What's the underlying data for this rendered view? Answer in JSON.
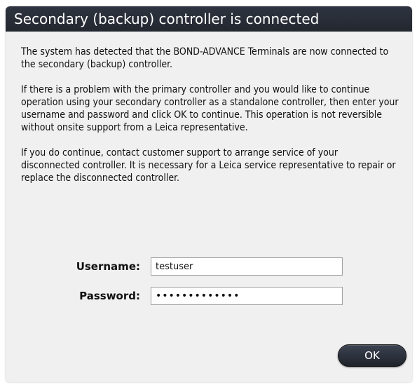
{
  "dialog": {
    "title": "Secondary (backup) controller is connected",
    "paragraphs": [
      "The system has detected that the BOND-ADVANCE Terminals are now connected to the secondary (backup) controller.",
      "If there is a problem with the primary controller and you would like to continue operation using your secondary controller as a standalone controller, then enter your username and password and click OK to continue. This operation is not reversible without onsite support from a Leica representative.",
      "If you do continue, contact customer support to arrange service of your disconnected controller. It is necessary for a Leica service representative to repair or replace the disconnected controller."
    ],
    "username": {
      "label": "Username:",
      "value": "testuser"
    },
    "password": {
      "label": "Password:",
      "value": "•••••••••••••"
    },
    "ok_label": "OK"
  },
  "colors": {
    "titlebar": "#23272f",
    "dialog_background": "#f0f0f0",
    "button": "#2b303a"
  }
}
